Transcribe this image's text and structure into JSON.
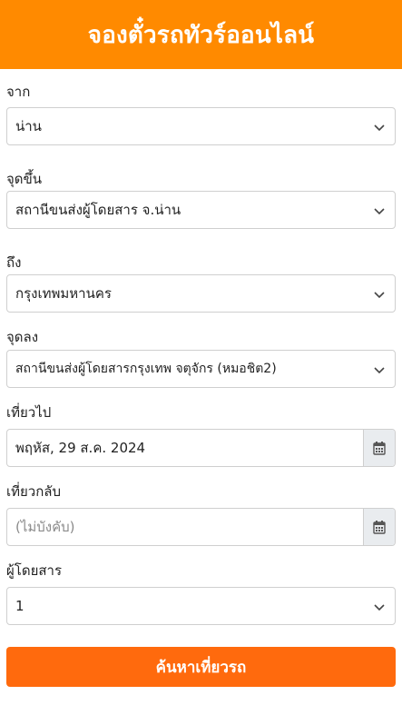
{
  "header": {
    "title": "จองตั๋วรถทัวร์ออนไลน์"
  },
  "form": {
    "from": {
      "label": "จาก",
      "value": "น่าน"
    },
    "boarding": {
      "label": "จุดขึ้น",
      "value": "สถานีขนส่งผู้โดยสาร จ.น่าน"
    },
    "to": {
      "label": "ถึง",
      "value": "กรุงเทพมหานคร"
    },
    "dropoff": {
      "label": "จุดลง",
      "value": "สถานีขนส่งผู้โดยสารกรุงเทพ จตุจักร (หมอชิต2)"
    },
    "depart": {
      "label": "เที่ยวไป",
      "value": "พฤหัส, 29 ส.ค. 2024",
      "icon": "calendar-icon"
    },
    "return": {
      "label": "เที่ยวกลับ",
      "placeholder": "(ไม่บังคับ)",
      "icon": "calendar-icon"
    },
    "passengers": {
      "label": "ผู้โดยสาร",
      "value": "1"
    },
    "search_button": "ค้นหาเที่ยวรถ"
  },
  "colors": {
    "header": "#ff8a00",
    "button": "#ff6a0d"
  }
}
